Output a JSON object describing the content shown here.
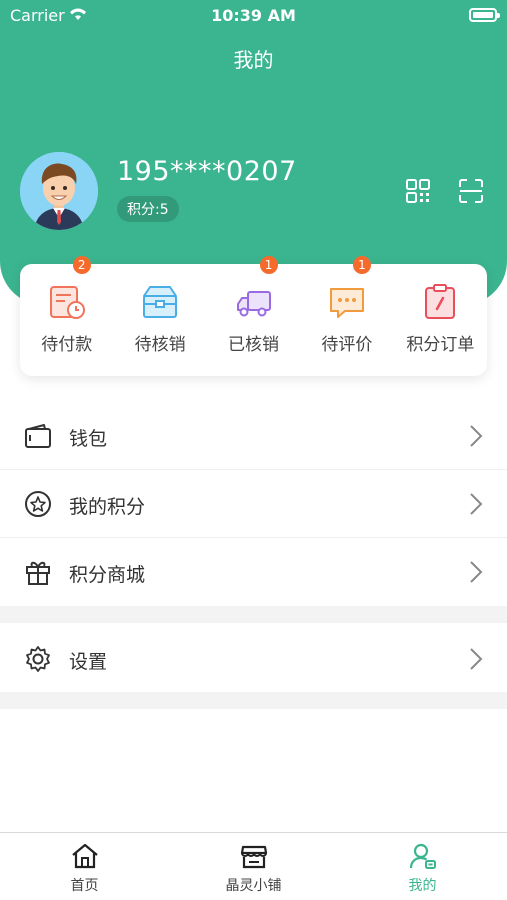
{
  "status_bar": {
    "carrier": "Carrier",
    "time": "10:39 AM"
  },
  "header": {
    "title": "我的"
  },
  "profile": {
    "phone": "195****0207",
    "points": "积分:5"
  },
  "orders": [
    {
      "label": "待付款",
      "badge": "2",
      "icon": "pending-payment-icon"
    },
    {
      "label": "待核销",
      "badge": "",
      "icon": "pending-verify-icon"
    },
    {
      "label": "已核销",
      "badge": "1",
      "icon": "verified-truck-icon"
    },
    {
      "label": "待评价",
      "badge": "1",
      "icon": "pending-review-icon"
    },
    {
      "label": "积分订单",
      "badge": "",
      "icon": "points-order-icon"
    }
  ],
  "menu": [
    {
      "label": "钱包",
      "icon": "wallet-icon"
    },
    {
      "label": "我的积分",
      "icon": "star-icon"
    },
    {
      "label": "积分商城",
      "icon": "gift-icon"
    },
    {
      "label": "设置",
      "icon": "gear-icon"
    }
  ],
  "tabbar": [
    {
      "label": "首页",
      "icon": "home-icon",
      "active": false
    },
    {
      "label": "晶灵小铺",
      "icon": "shop-icon",
      "active": false
    },
    {
      "label": "我的",
      "icon": "user-icon",
      "active": true
    }
  ],
  "colors": {
    "brand": "#3bb58f",
    "badge": "#f46b2c"
  }
}
